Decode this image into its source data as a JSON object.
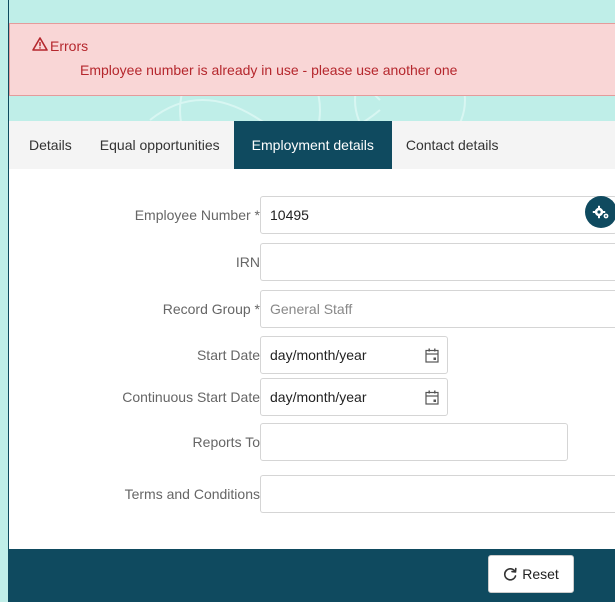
{
  "errors": {
    "title": "Errors",
    "message": "Employee number is already in use - please use another one"
  },
  "tabs": [
    {
      "label": "Details",
      "active": false
    },
    {
      "label": "Equal opportunities",
      "active": false
    },
    {
      "label": "Employment details",
      "active": true
    },
    {
      "label": "Contact details",
      "active": false
    }
  ],
  "form": {
    "employee_number": {
      "label": "Employee Number *",
      "value": "10495"
    },
    "irn": {
      "label": "IRN",
      "value": ""
    },
    "record_group": {
      "label": "Record Group *",
      "value": "General Staff"
    },
    "start_date": {
      "label": "Start Date",
      "value": "day/month/year"
    },
    "continuous_start_date": {
      "label": "Continuous Start Date",
      "value": "day/month/year"
    },
    "reports_to": {
      "label": "Reports To",
      "value": ""
    },
    "terms_and_conditions": {
      "label": "Terms and Conditions",
      "value": ""
    }
  },
  "footer": {
    "reset_label": "Reset"
  },
  "colors": {
    "primary": "#0f4a5f",
    "error_bg": "#f9d6d6",
    "error_text": "#b5272d",
    "page_bg": "#bfeee8"
  }
}
